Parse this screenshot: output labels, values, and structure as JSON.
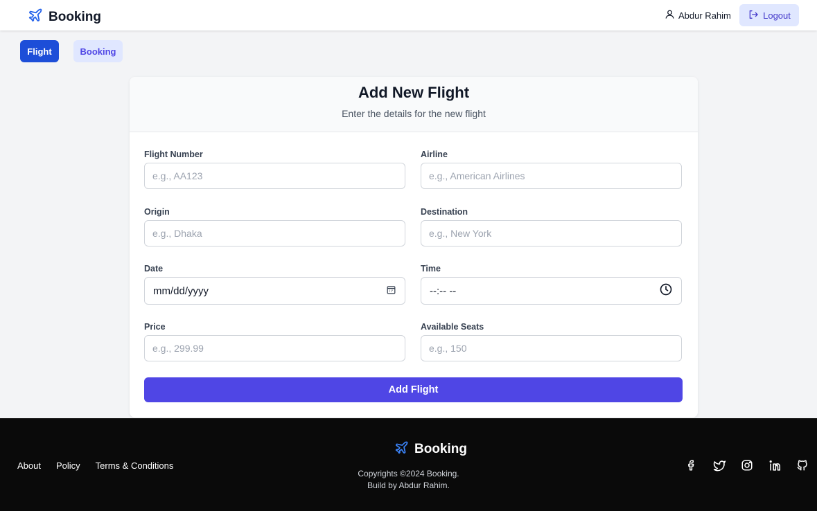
{
  "header": {
    "brand": "Booking",
    "user_name": "Abdur Rahim",
    "logout_label": "Logout"
  },
  "nav": {
    "tabs": [
      {
        "label": "Flight",
        "active": true
      },
      {
        "label": "Booking",
        "active": false
      }
    ]
  },
  "form": {
    "title": "Add New Flight",
    "subtitle": "Enter the details for the new flight",
    "fields": {
      "flight_number": {
        "label": "Flight Number",
        "placeholder": "e.g., AA123"
      },
      "airline": {
        "label": "Airline",
        "placeholder": "e.g., American Airlines"
      },
      "origin": {
        "label": "Origin",
        "placeholder": "e.g., Dhaka"
      },
      "destination": {
        "label": "Destination",
        "placeholder": "e.g., New York"
      },
      "date": {
        "label": "Date",
        "value": "mm/dd/yyyy"
      },
      "time": {
        "label": "Time",
        "value": "--:-- --"
      },
      "price": {
        "label": "Price",
        "placeholder": "e.g., 299.99"
      },
      "seats": {
        "label": "Available Seats",
        "placeholder": "e.g., 150"
      }
    },
    "submit_label": "Add Flight"
  },
  "footer": {
    "links": [
      "About",
      "Policy",
      "Terms & Conditions"
    ],
    "brand": "Booking",
    "copyright": "Copyrights ©2024 Booking.",
    "credit": "Build by Abdur Rahim.",
    "socials": [
      "facebook-icon",
      "twitter-icon",
      "instagram-icon",
      "linkedin-icon",
      "github-icon"
    ]
  },
  "colors": {
    "accent": "#4f46e5",
    "primary_blue": "#1d4ed8",
    "tab_bg": "#e0e7ff",
    "footer_bg": "#0a0a0a"
  }
}
